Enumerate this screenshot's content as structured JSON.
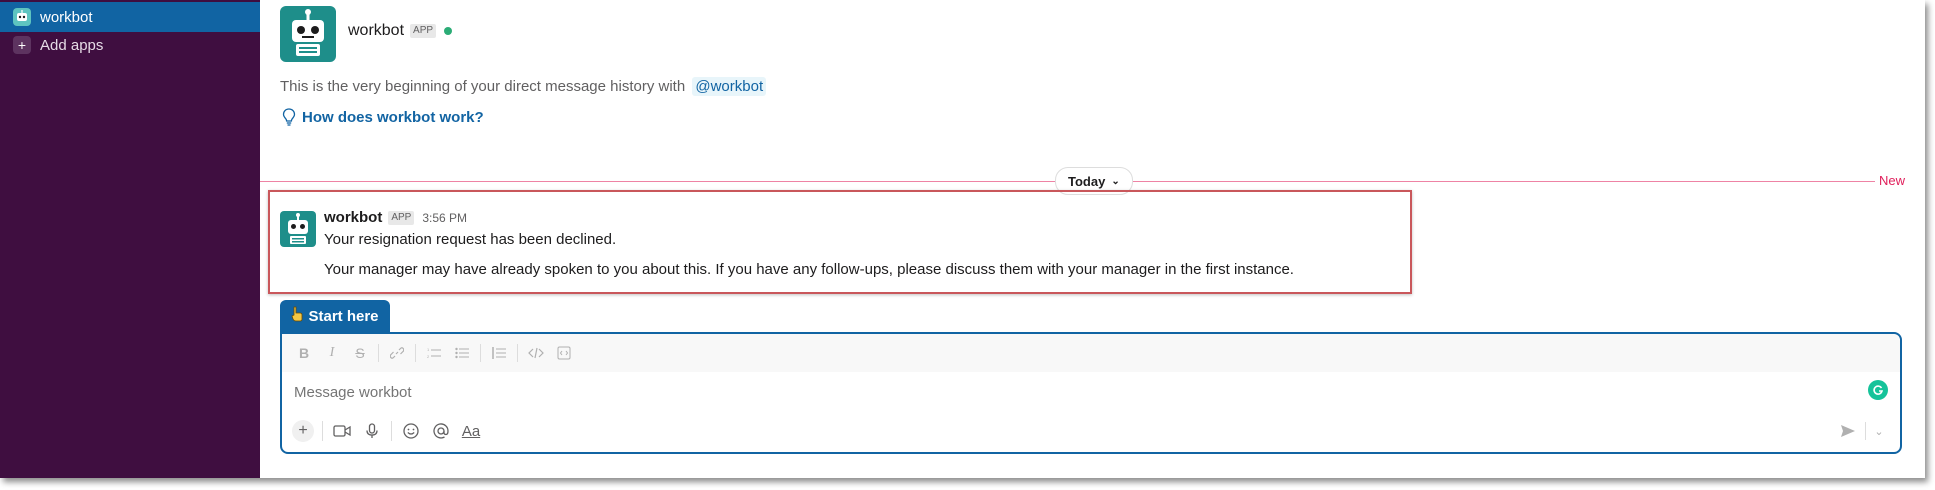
{
  "sidebar": {
    "items": [
      {
        "label": "workbot",
        "icon": "workbot-icon",
        "active": true
      },
      {
        "label": "Add apps",
        "icon": "plus-icon"
      }
    ]
  },
  "intro": {
    "name": "workbot",
    "badge": "APP",
    "text": "This is the very beginning of your direct message history with",
    "mention": "@workbot",
    "link": "How does workbot work?"
  },
  "divider": {
    "today": "Today",
    "new_label": "New"
  },
  "message": {
    "author": "workbot",
    "badge": "APP",
    "time": "3:56 PM",
    "line1": "Your resignation request has been declined.",
    "line2": "Your manager may have already spoken to you about this. If you have any follow-ups, please discuss them with your manager in the first instance."
  },
  "composer": {
    "tab_label": "Start here",
    "placeholder": "Message workbot",
    "formatting": [
      "bold",
      "italic",
      "strikethrough",
      "link",
      "ordered-list",
      "bulleted-list",
      "blockquote",
      "code",
      "code-block"
    ],
    "aa_label": "Aa"
  },
  "colors": {
    "sidebar_bg": "#3f0e40",
    "active_item": "#1164a3",
    "new_divider": "#e01e5a",
    "link": "#1264a3",
    "bot_avatar": "#1e8e8a"
  }
}
